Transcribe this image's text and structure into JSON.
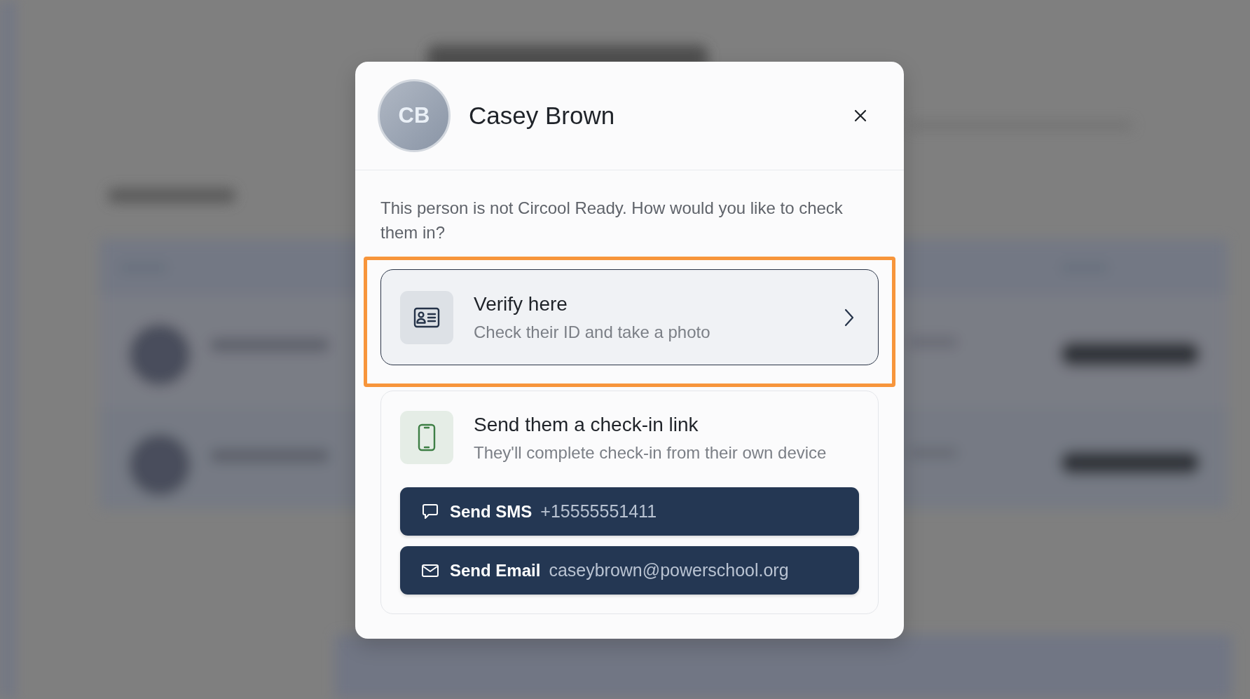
{
  "dialog": {
    "avatar_initials": "CB",
    "title": "Casey Brown",
    "message": "This person is not Circool Ready. How would you like to check them in?"
  },
  "options": [
    {
      "kind": "verify",
      "title": "Verify here",
      "subtitle": "Check their ID and take a photo",
      "highlighted": true
    },
    {
      "kind": "send",
      "title": "Send them a check-in link",
      "subtitle": "They'll complete check-in from their own device",
      "highlighted": false,
      "buttons": [
        {
          "kind": "sms",
          "label": "Send SMS",
          "detail": "+15555551411"
        },
        {
          "kind": "email",
          "label": "Send Email",
          "detail": "caseybrown@powerschool.org"
        }
      ]
    }
  ]
}
